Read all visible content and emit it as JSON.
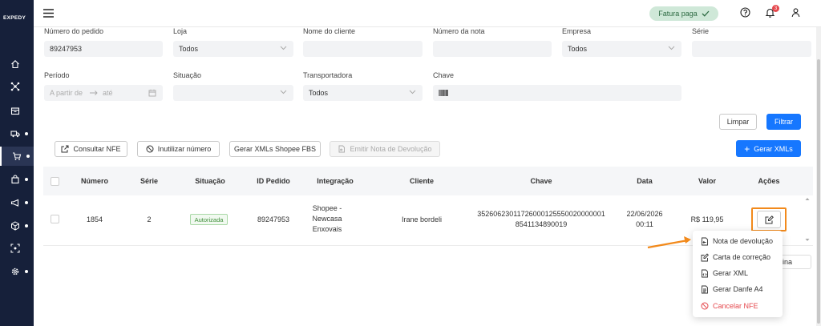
{
  "app": {
    "logo": "EXPEDY"
  },
  "topbar": {
    "status_label": "Fatura paga",
    "notification_count": "3"
  },
  "filters": {
    "numero_pedido": {
      "label": "Número do pedido",
      "value": "89247953"
    },
    "loja": {
      "label": "Loja",
      "value": "Todos"
    },
    "nome_cliente": {
      "label": "Nome do cliente",
      "value": ""
    },
    "numero_nota": {
      "label": "Número da nota",
      "value": ""
    },
    "empresa": {
      "label": "Empresa",
      "value": "Todos"
    },
    "serie": {
      "label": "Série",
      "value": ""
    },
    "periodo": {
      "label": "Período",
      "from_placeholder": "A partir de",
      "to_placeholder": "até"
    },
    "situacao": {
      "label": "Situação",
      "value": ""
    },
    "transportadora": {
      "label": "Transportadora",
      "value": "Todos"
    },
    "chave": {
      "label": "Chave",
      "value": ""
    },
    "limpar_label": "Limpar",
    "filtrar_label": "Filtrar"
  },
  "toolbar": {
    "consultar_nfe": "Consultar NFE",
    "inutilizar_numero": "Inutilizar número",
    "gerar_xmls_shopee": "Gerar XMLs Shopee FBS",
    "emitir_nota_devolucao": "Emitir Nota de Devolução",
    "gerar_xmls": "Gerar XMLs"
  },
  "table": {
    "columns": [
      "Número",
      "Série",
      "Situação",
      "ID Pedido",
      "Integração",
      "Cliente",
      "Chave",
      "Data",
      "Valor",
      "Ações"
    ],
    "rows": [
      {
        "numero": "1854",
        "serie": "2",
        "situacao": "Autorizada",
        "id_pedido": "89247953",
        "integracao_line1": "Shopee -",
        "integracao_line2": "Newcasa",
        "integracao_line3": "Enxovais",
        "cliente": "Irane bordeli",
        "chave_line1": "35260623011726000125550020000001",
        "chave_line2": "8541134890019",
        "data_line1": "22/06/2026",
        "data_line2": "00:11",
        "valor": "R$ 119,95"
      }
    ]
  },
  "actions_menu": {
    "items": [
      {
        "label": "Nota de devolução",
        "icon": "file-return-icon"
      },
      {
        "label": "Carta de correção",
        "icon": "edit-note-icon"
      },
      {
        "label": "Gerar XML",
        "icon": "file-code-icon"
      },
      {
        "label": "Gerar Danfe A4",
        "icon": "file-text-icon"
      },
      {
        "label": "Cancelar NFE",
        "icon": "ban-icon"
      }
    ]
  },
  "pagination": {
    "per_page_label": "gina"
  },
  "colors": {
    "primary": "#1677ff",
    "sidebar": "#16203a",
    "highlight": "#f28a1c",
    "danger": "#e5484d",
    "success": "#3f8f3a"
  }
}
